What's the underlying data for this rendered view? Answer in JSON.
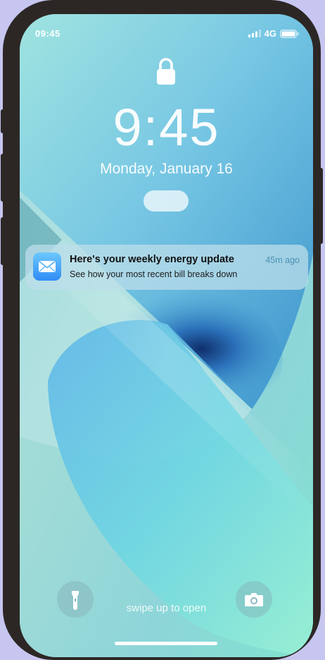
{
  "status_bar": {
    "time": "09:45",
    "network": "4G"
  },
  "lock_screen": {
    "time": "9:45",
    "date": "Monday, January 16"
  },
  "notification": {
    "app_icon": "mail-icon",
    "title": "Here's your weekly energy update",
    "age": "45m ago",
    "body": "See how your most recent bill breaks down"
  },
  "controls": {
    "left_icon": "flashlight-icon",
    "right_icon": "camera-icon",
    "swipe_hint": "swipe up to open"
  },
  "colors": {
    "background": "#c7c6f0",
    "phone_frame": "#2c2725",
    "notification_age": "#4a93b3"
  }
}
